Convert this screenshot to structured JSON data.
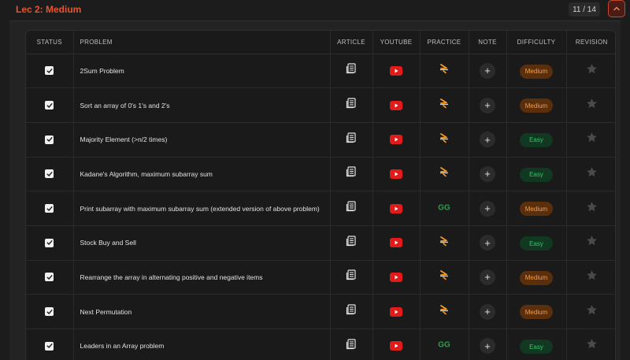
{
  "section": {
    "title": "Lec 2: Medium",
    "counter": "11 / 14"
  },
  "columns": {
    "status": "STATUS",
    "problem": "PROBLEM",
    "article": "ARTICLE",
    "youtube": "YOUTUBE",
    "practice": "PRACTICE",
    "note": "NOTE",
    "difficulty": "DIFFICULTY",
    "revision": "REVISION"
  },
  "note_symbol": "+",
  "colors": {
    "accent": "#e8552f",
    "medium": "#f0a04a",
    "easy": "#39c56a",
    "youtube": "#e11a1a"
  },
  "rows": [
    {
      "problem": "2Sum Problem",
      "practice_icon": "codingninjas-icon",
      "difficulty": "Medium",
      "difficulty_class": "medium"
    },
    {
      "problem": "Sort an array of 0's 1's and 2's",
      "practice_icon": "codingninjas-icon",
      "difficulty": "Medium",
      "difficulty_class": "medium"
    },
    {
      "problem": "Majority Element (>n/2 times)",
      "practice_icon": "codingninjas-icon",
      "difficulty": "Easy",
      "difficulty_class": "easy"
    },
    {
      "problem": "Kadane's Algorithm, maximum subarray sum",
      "practice_icon": "codingninjas-icon",
      "difficulty": "Easy",
      "difficulty_class": "easy"
    },
    {
      "problem": "Print subarray with maximum subarray sum (extended version of above problem)",
      "practice_icon": "geeksforgeeks-icon",
      "difficulty": "Medium",
      "difficulty_class": "medium"
    },
    {
      "problem": "Stock Buy and Sell",
      "practice_icon": "codingninjas-icon",
      "difficulty": "Easy",
      "difficulty_class": "easy"
    },
    {
      "problem": "Rearrange the array in alternating positive and negative items",
      "practice_icon": "codingninjas-icon",
      "difficulty": "Medium",
      "difficulty_class": "medium"
    },
    {
      "problem": "Next Permutation",
      "practice_icon": "codingninjas-icon",
      "difficulty": "Medium",
      "difficulty_class": "medium"
    },
    {
      "problem": "Leaders in an Array problem",
      "practice_icon": "geeksforgeeks-icon",
      "difficulty": "Easy",
      "difficulty_class": "easy"
    }
  ]
}
